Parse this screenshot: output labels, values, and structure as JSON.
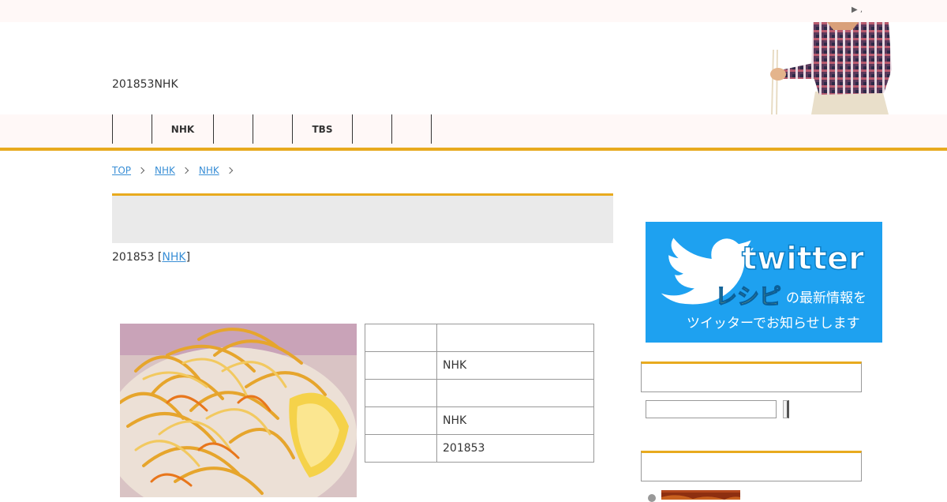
{
  "topbar": {
    "marker": "▶ ,"
  },
  "header": {
    "site_title": "201853NHK"
  },
  "nav": {
    "items": [
      {
        "label": ""
      },
      {
        "label": "NHK"
      },
      {
        "label": ""
      },
      {
        "label": ""
      },
      {
        "label": "TBS"
      },
      {
        "label": ""
      },
      {
        "label": ""
      }
    ]
  },
  "breadcrumb": {
    "items": [
      {
        "label": "TOP"
      },
      {
        "label": "NHK"
      },
      {
        "label": "NHK"
      }
    ]
  },
  "article": {
    "title": "",
    "meta_date": "201853",
    "meta_category": "NHK",
    "info_table": [
      {
        "key": "",
        "value": ""
      },
      {
        "key": "",
        "value": "NHK"
      },
      {
        "key": "",
        "value": ""
      },
      {
        "key": "",
        "value": "NHK"
      },
      {
        "key": "",
        "value": "201853"
      }
    ]
  },
  "sidebar": {
    "twitter_banner": {
      "logo_text": "twitter",
      "recipe_text": "レシピ",
      "latest_text": "の最新情報を",
      "tagline": "ツイッターでお知らせします"
    },
    "search": {
      "input_value": "",
      "button_label": ""
    }
  },
  "colors": {
    "accent": "#e8aa1e",
    "twitter_blue": "#1ea1f0",
    "link": "#3a8fd6",
    "nav_bg": "#fff8f7"
  }
}
